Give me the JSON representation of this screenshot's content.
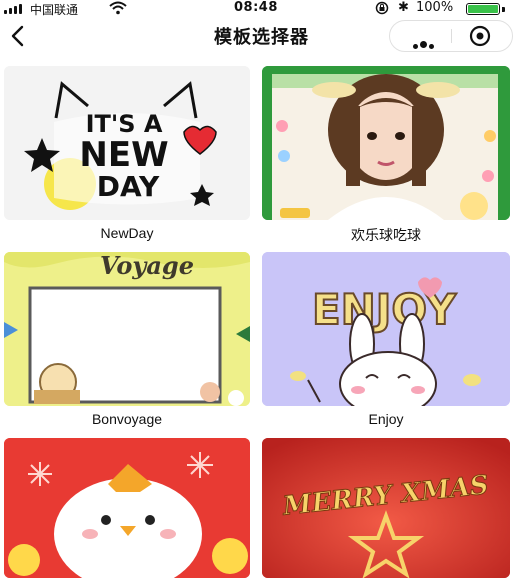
{
  "status_bar": {
    "carrier": "中国联通",
    "time": "08:48",
    "battery_pct": "100%",
    "battery_level": 1.0,
    "battery_color": "#3ac24a",
    "bluetooth": "✱"
  },
  "nav": {
    "title": "模板选择器",
    "back_icon": "chevron-left-icon",
    "more_icon": "more-dots-icon",
    "close_icon": "target-circle-icon"
  },
  "templates": [
    {
      "name": "NewDay",
      "art": [
        "IT'S A",
        "NEW",
        "DAY"
      ]
    },
    {
      "name": "欢乐球吃球",
      "art": []
    },
    {
      "name": "Bonvoyage",
      "art": [
        "Voyage"
      ]
    },
    {
      "name": "Enjoy",
      "art": [
        "ENJOY"
      ]
    },
    {
      "name": "",
      "art": []
    },
    {
      "name": "",
      "art": [
        "MERRY XMAS"
      ]
    }
  ]
}
